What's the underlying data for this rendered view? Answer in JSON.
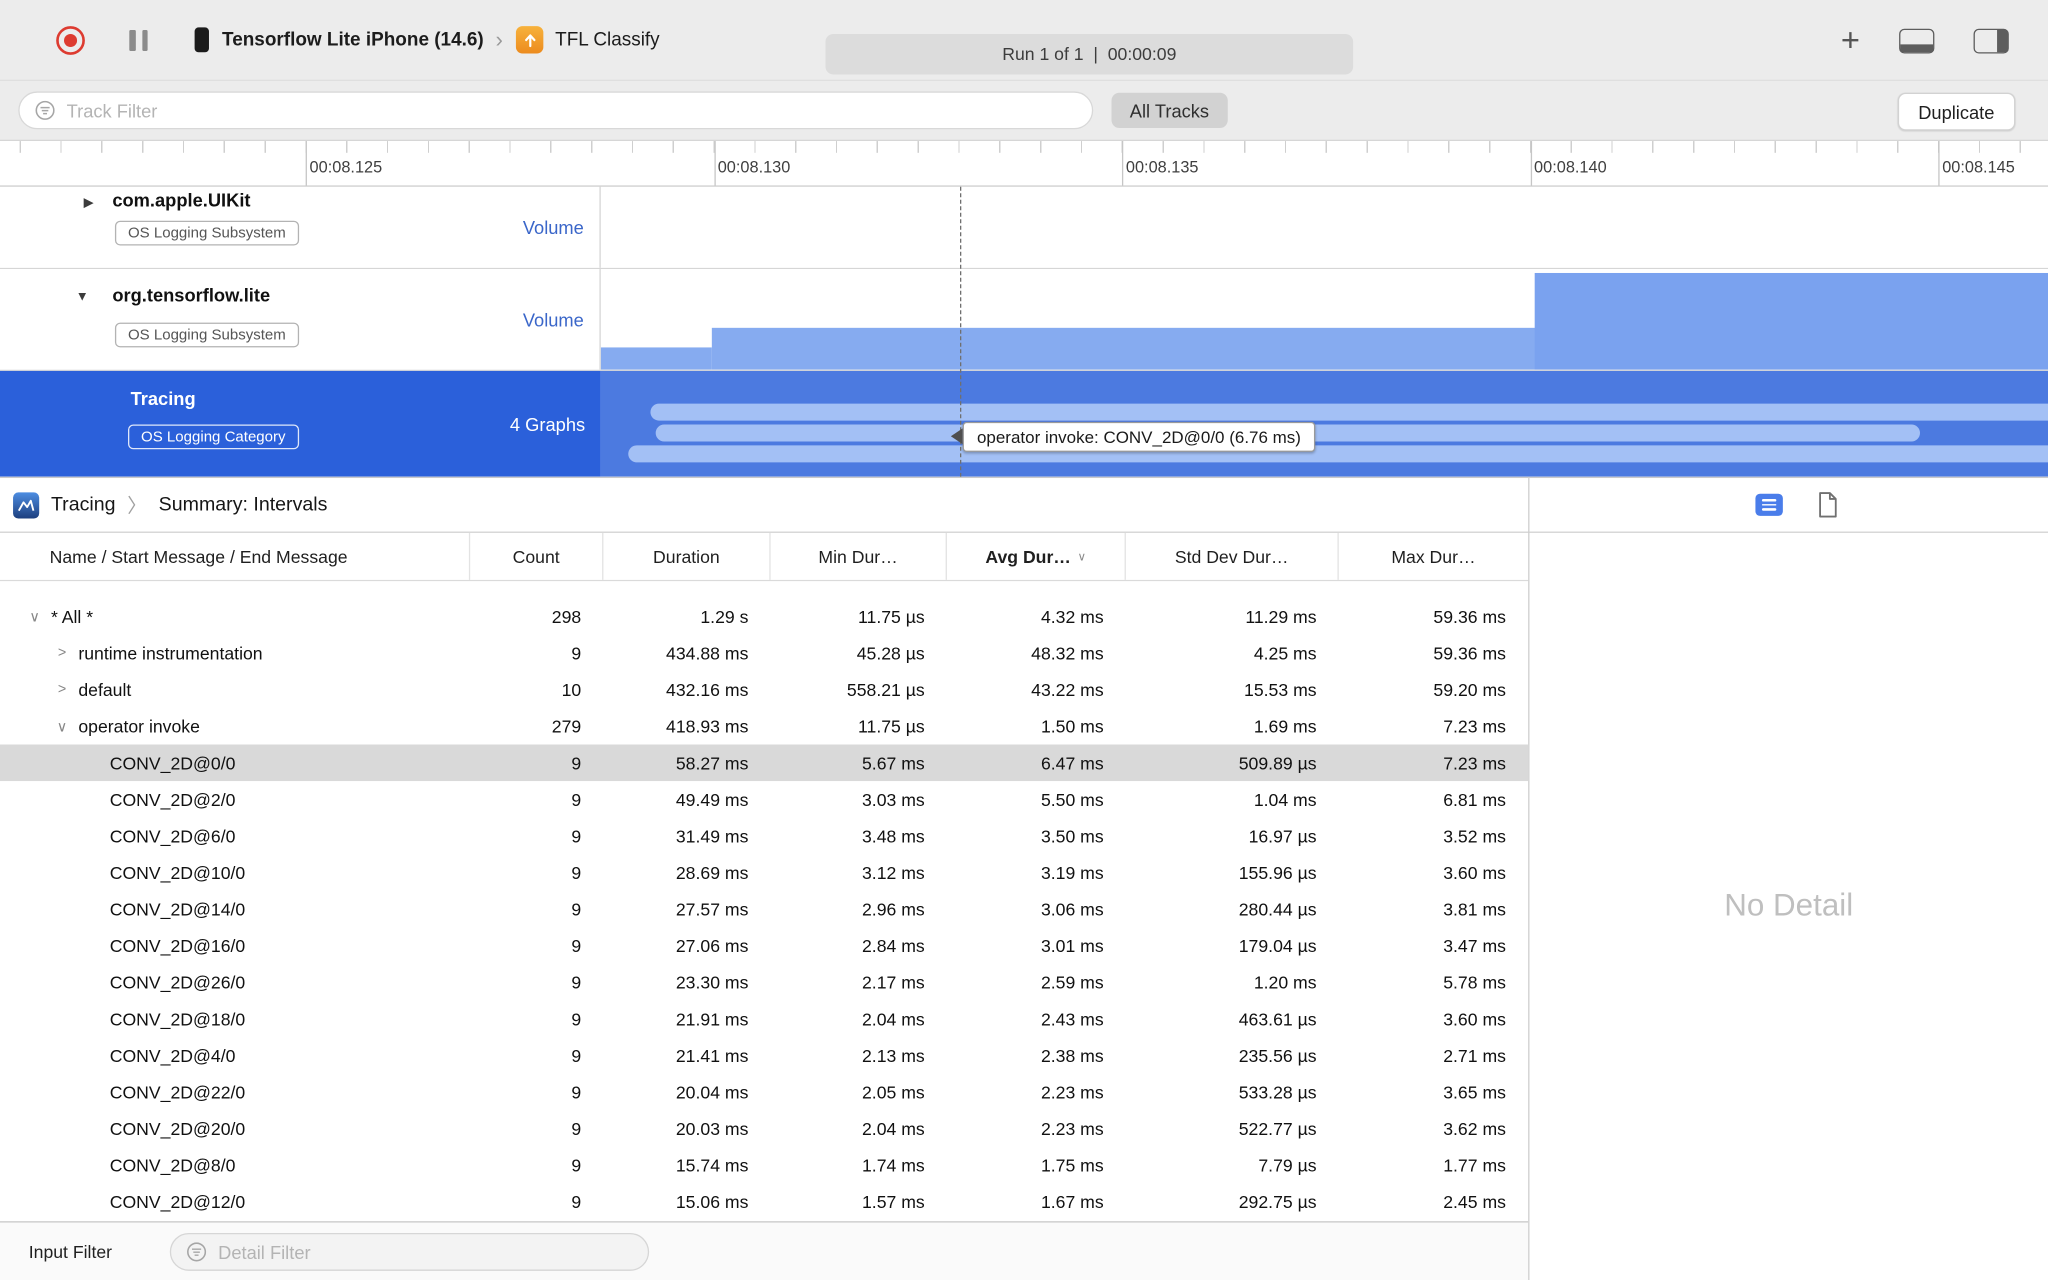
{
  "toolbar": {
    "device_name": "Tensorflow Lite iPhone (14.6)",
    "separator": "›",
    "app_name": "TFL Classify",
    "run_status": "Run 1 of 1  |  00:00:09",
    "add_label": "+"
  },
  "filter_bar": {
    "track_filter_placeholder": "Track Filter",
    "all_tracks_label": "All Tracks",
    "duplicate_label": "Duplicate"
  },
  "ruler": {
    "tick_labels": [
      "00:08.125",
      "00:08.130",
      "00:08.135",
      "00:08.140",
      "00:08.145"
    ]
  },
  "tracks": [
    {
      "name": "com.apple.UIKit",
      "badge": "OS Logging Subsystem",
      "meta": "Volume",
      "disclosure": "▶"
    },
    {
      "name": "org.tensorflow.lite",
      "badge": "OS Logging Subsystem",
      "meta": "Volume",
      "disclosure": "▼"
    },
    {
      "name": "Tracing",
      "badge": "OS Logging Category",
      "meta": "4 Graphs"
    }
  ],
  "track_tooltip": "operator invoke: CONV_2D@0/0 (6.76 ms)",
  "breadcrumb": {
    "instrument": "Tracing",
    "separator": "〉",
    "view": "Summary: Intervals"
  },
  "table": {
    "columns": {
      "name": "Name / Start Message / End Message",
      "count": "Count",
      "duration": "Duration",
      "min": "Min Dur…",
      "avg": "Avg Dur…",
      "std": "Std Dev Dur…",
      "max": "Max Dur…"
    },
    "sort_indicator": "∨",
    "rows": [
      {
        "indent": 0,
        "chevron": "down",
        "name": "* All *",
        "count": "298",
        "duration": "1.29 s",
        "min": "11.75 µs",
        "avg": "4.32 ms",
        "std": "11.29 ms",
        "max": "59.36 ms",
        "selected": false
      },
      {
        "indent": 1,
        "chevron": "right",
        "name": "runtime instrumentation",
        "count": "9",
        "duration": "434.88 ms",
        "min": "45.28 µs",
        "avg": "48.32 ms",
        "std": "4.25 ms",
        "max": "59.36 ms",
        "selected": false
      },
      {
        "indent": 1,
        "chevron": "right",
        "name": "default",
        "count": "10",
        "duration": "432.16 ms",
        "min": "558.21 µs",
        "avg": "43.22 ms",
        "std": "15.53 ms",
        "max": "59.20 ms",
        "selected": false
      },
      {
        "indent": 1,
        "chevron": "down",
        "name": "operator invoke",
        "count": "279",
        "duration": "418.93 ms",
        "min": "11.75 µs",
        "avg": "1.50 ms",
        "std": "1.69 ms",
        "max": "7.23 ms",
        "selected": false
      },
      {
        "indent": 2,
        "chevron": null,
        "name": "CONV_2D@0/0",
        "count": "9",
        "duration": "58.27 ms",
        "min": "5.67 ms",
        "avg": "6.47 ms",
        "std": "509.89 µs",
        "max": "7.23 ms",
        "selected": true
      },
      {
        "indent": 2,
        "chevron": null,
        "name": "CONV_2D@2/0",
        "count": "9",
        "duration": "49.49 ms",
        "min": "3.03 ms",
        "avg": "5.50 ms",
        "std": "1.04 ms",
        "max": "6.81 ms",
        "selected": false
      },
      {
        "indent": 2,
        "chevron": null,
        "name": "CONV_2D@6/0",
        "count": "9",
        "duration": "31.49 ms",
        "min": "3.48 ms",
        "avg": "3.50 ms",
        "std": "16.97 µs",
        "max": "3.52 ms",
        "selected": false
      },
      {
        "indent": 2,
        "chevron": null,
        "name": "CONV_2D@10/0",
        "count": "9",
        "duration": "28.69 ms",
        "min": "3.12 ms",
        "avg": "3.19 ms",
        "std": "155.96 µs",
        "max": "3.60 ms",
        "selected": false
      },
      {
        "indent": 2,
        "chevron": null,
        "name": "CONV_2D@14/0",
        "count": "9",
        "duration": "27.57 ms",
        "min": "2.96 ms",
        "avg": "3.06 ms",
        "std": "280.44 µs",
        "max": "3.81 ms",
        "selected": false
      },
      {
        "indent": 2,
        "chevron": null,
        "name": "CONV_2D@16/0",
        "count": "9",
        "duration": "27.06 ms",
        "min": "2.84 ms",
        "avg": "3.01 ms",
        "std": "179.04 µs",
        "max": "3.47 ms",
        "selected": false
      },
      {
        "indent": 2,
        "chevron": null,
        "name": "CONV_2D@26/0",
        "count": "9",
        "duration": "23.30 ms",
        "min": "2.17 ms",
        "avg": "2.59 ms",
        "std": "1.20 ms",
        "max": "5.78 ms",
        "selected": false
      },
      {
        "indent": 2,
        "chevron": null,
        "name": "CONV_2D@18/0",
        "count": "9",
        "duration": "21.91 ms",
        "min": "2.04 ms",
        "avg": "2.43 ms",
        "std": "463.61 µs",
        "max": "3.60 ms",
        "selected": false
      },
      {
        "indent": 2,
        "chevron": null,
        "name": "CONV_2D@4/0",
        "count": "9",
        "duration": "21.41 ms",
        "min": "2.13 ms",
        "avg": "2.38 ms",
        "std": "235.56 µs",
        "max": "2.71 ms",
        "selected": false
      },
      {
        "indent": 2,
        "chevron": null,
        "name": "CONV_2D@22/0",
        "count": "9",
        "duration": "20.04 ms",
        "min": "2.05 ms",
        "avg": "2.23 ms",
        "std": "533.28 µs",
        "max": "3.65 ms",
        "selected": false
      },
      {
        "indent": 2,
        "chevron": null,
        "name": "CONV_2D@20/0",
        "count": "9",
        "duration": "20.03 ms",
        "min": "2.04 ms",
        "avg": "2.23 ms",
        "std": "522.77 µs",
        "max": "3.62 ms",
        "selected": false
      },
      {
        "indent": 2,
        "chevron": null,
        "name": "CONV_2D@8/0",
        "count": "9",
        "duration": "15.74 ms",
        "min": "1.74 ms",
        "avg": "1.75 ms",
        "std": "7.79 µs",
        "max": "1.77 ms",
        "selected": false
      },
      {
        "indent": 2,
        "chevron": null,
        "name": "CONV_2D@12/0",
        "count": "9",
        "duration": "15.06 ms",
        "min": "1.57 ms",
        "avg": "1.67 ms",
        "std": "292.75 µs",
        "max": "2.45 ms",
        "selected": false
      }
    ]
  },
  "detail_panel": {
    "empty_label": "No Detail"
  },
  "bottom_bar": {
    "input_filter_label": "Input Filter",
    "detail_filter_placeholder": "Detail Filter"
  },
  "colors": {
    "accent_blue": "#2b60da",
    "track_bar_blue": "#86abf0",
    "capsule_blue": "#a3c0f5",
    "selected_row": "#d9d9d9"
  }
}
